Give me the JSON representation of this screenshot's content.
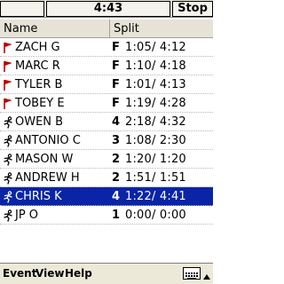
{
  "titlebar": {
    "time": "4:43",
    "stop_label": "Stop"
  },
  "columns": {
    "name": "Name",
    "split": "Split"
  },
  "rows": [
    {
      "icon": "flag-icon",
      "name": "ZACH G",
      "lap": "F",
      "split": "1:05/ 4:12",
      "selected": false
    },
    {
      "icon": "flag-icon",
      "name": "MARC R",
      "lap": "F",
      "split": "1:10/ 4:18",
      "selected": false
    },
    {
      "icon": "flag-icon",
      "name": "TYLER B",
      "lap": "F",
      "split": "1:01/ 4:13",
      "selected": false
    },
    {
      "icon": "flag-icon",
      "name": "TOBEY E",
      "lap": "F",
      "split": "1:19/ 4:28",
      "selected": false
    },
    {
      "icon": "runner-icon",
      "name": "OWEN B",
      "lap": "4",
      "split": "2:18/ 4:32",
      "selected": false
    },
    {
      "icon": "runner-icon",
      "name": "ANTONIO C",
      "lap": "3",
      "split": "1:08/ 2:30",
      "selected": false
    },
    {
      "icon": "runner-icon",
      "name": "MASON W",
      "lap": "2",
      "split": "1:20/ 1:20",
      "selected": false
    },
    {
      "icon": "runner-icon",
      "name": "ANDREW H",
      "lap": "2",
      "split": "1:51/ 1:51",
      "selected": false
    },
    {
      "icon": "runner-icon",
      "name": "CHRIS K",
      "lap": "4",
      "split": "1:22/ 4:41",
      "selected": true
    },
    {
      "icon": "runner-icon",
      "name": "JP O",
      "lap": "1",
      "split": "0:00/ 0:00",
      "selected": false
    }
  ],
  "menu": {
    "event": "Event",
    "view": "View",
    "help": "Help"
  }
}
